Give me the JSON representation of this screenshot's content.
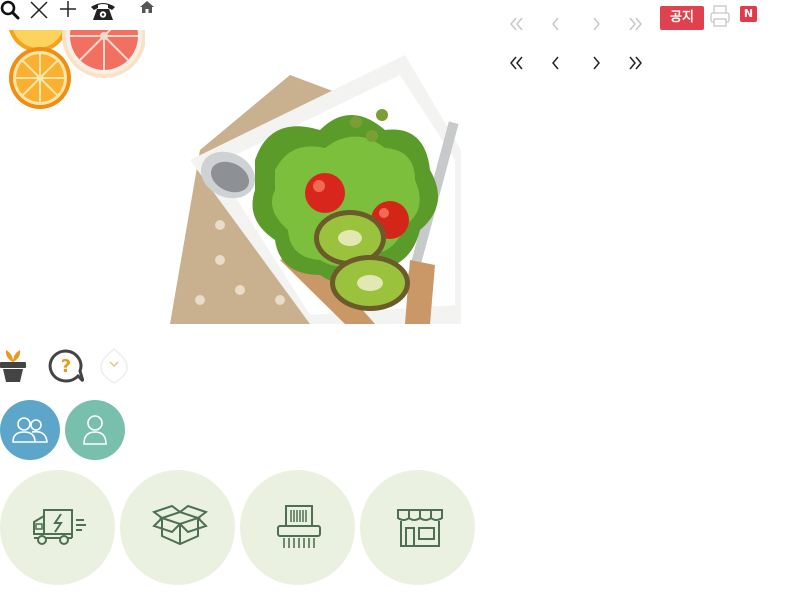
{
  "toolbar": {
    "icons": [
      "search-icon",
      "close-icon",
      "plus-icon",
      "phone-icon",
      "home-icon"
    ]
  },
  "pager": {
    "badge_notice": "공지",
    "badge_new": "N",
    "icons": [
      "first-page-icon",
      "prev-page-icon",
      "next-page-icon",
      "last-page-icon",
      "print-icon"
    ]
  },
  "hero": {
    "images": [
      "citrus-slices-image",
      "salad-plate-image"
    ]
  },
  "quick_icons": [
    "plant-pot-icon",
    "question-bubble-icon",
    "chevron-down-badge-icon"
  ],
  "members": [
    "group-member-icon",
    "single-member-icon"
  ],
  "categories": [
    "delivery-truck-icon",
    "open-box-icon",
    "shredder-icon",
    "storefront-icon"
  ],
  "colors": {
    "badge_red": "#e0414f",
    "member_blue": "#5ea6c9",
    "member_teal": "#79bfae",
    "category_bg": "#ebf1e1",
    "category_icon": "#4e6f52",
    "plant_orange": "#e99a18"
  }
}
